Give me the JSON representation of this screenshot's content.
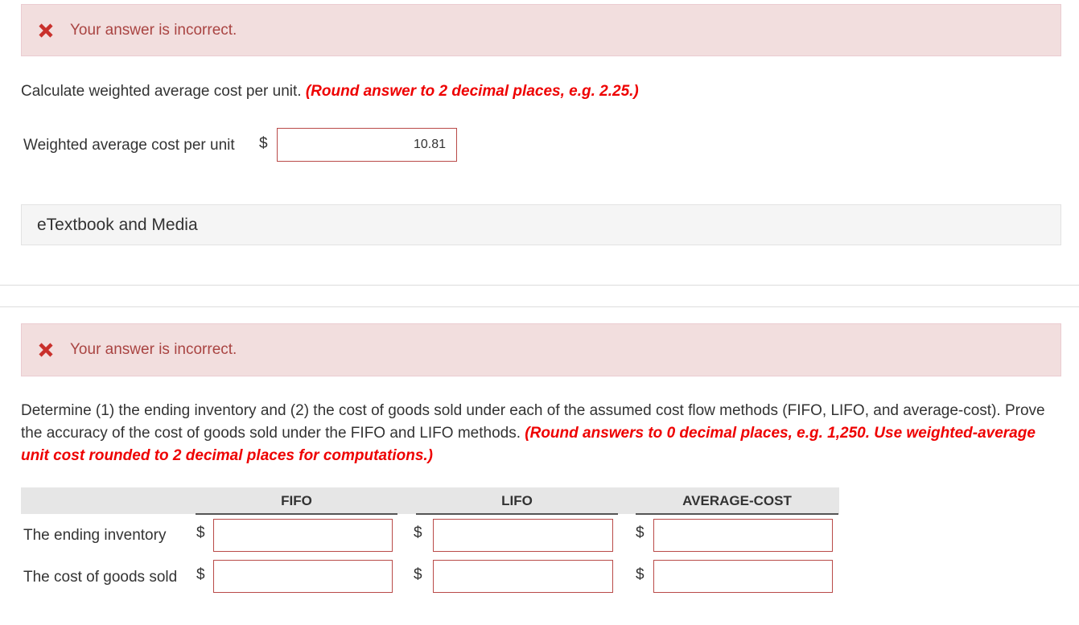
{
  "part1": {
    "alert_message": "Your answer is incorrect.",
    "question": "Calculate weighted average cost per unit.",
    "hint": "(Round answer to 2 decimal places, e.g. 2.25.)",
    "field_label": "Weighted average cost per unit",
    "currency": "$",
    "field_value": "10.81"
  },
  "etextbook": {
    "label": "eTextbook and Media"
  },
  "part2": {
    "alert_message": "Your answer is incorrect.",
    "question": "Determine (1) the ending inventory and (2) the cost of goods sold under each of the assumed cost flow methods (FIFO, LIFO, and average-cost). Prove the accuracy of the cost of goods sold under the FIFO and LIFO methods.",
    "hint": "(Round answers to 0 decimal places, e.g. 1,250. Use weighted-average unit cost rounded to 2 decimal places for computations.)",
    "columns": [
      "FIFO",
      "LIFO",
      "AVERAGE-COST"
    ],
    "currency": "$",
    "rows": [
      {
        "label": "The ending inventory",
        "values": [
          "",
          "",
          ""
        ]
      },
      {
        "label": "The cost of goods sold",
        "values": [
          "",
          "",
          ""
        ]
      }
    ]
  },
  "colors": {
    "alert_bg": "#f2dede",
    "alert_text": "#a94442",
    "hint": "#ee0000",
    "x_icon": "#c9302c"
  }
}
